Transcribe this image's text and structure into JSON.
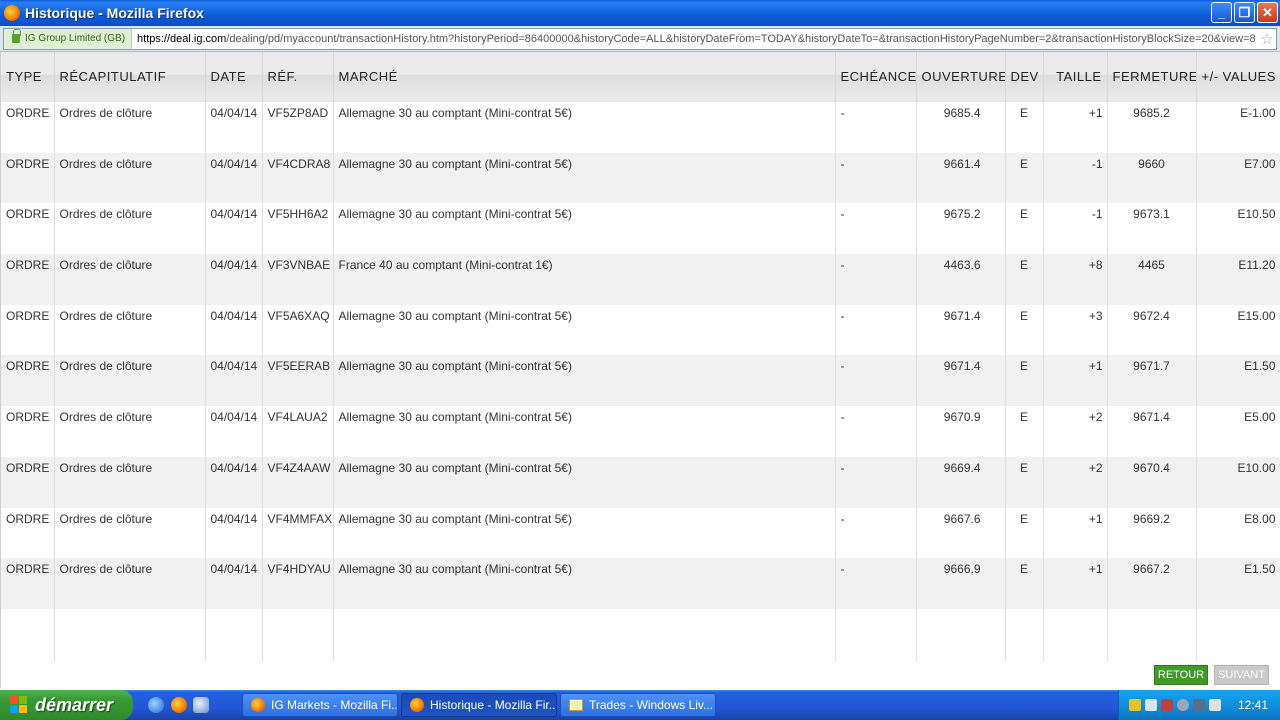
{
  "window": {
    "title": "Historique - Mozilla Firefox",
    "minimize": "_",
    "maximize": "❐",
    "close": "✕"
  },
  "address": {
    "site_identity": "IG Group Limited (GB)",
    "url_host": "https://deal.ig.com",
    "url_rest": "/dealing/pd/myaccount/transactionHistory.htm?historyPeriod=86400000&historyCode=ALL&historyDateFrom=TODAY&historyDateTo=&transactionHistoryPageNumber=2&transactionHistoryBlockSize=20&view=8"
  },
  "table": {
    "headers": [
      "TYPE",
      "RÉCAPITULATIF",
      "DATE",
      "RÉF.",
      "MARCHÉ",
      "ECHÉANCE",
      "OUVERTURE",
      "DEV",
      "TAILLE",
      "FERMETURE",
      "+/- VALUES"
    ],
    "rows": [
      [
        "ORDRE",
        "Ordres de clôture",
        "04/04/14",
        "VF5ZP8AD",
        "Allemagne 30 au comptant (Mini-contrat 5€)",
        "-",
        "9685.4",
        "E",
        "+1",
        "9685.2",
        "E-1.00"
      ],
      [
        "ORDRE",
        "Ordres de clôture",
        "04/04/14",
        "VF4CDRA8",
        "Allemagne 30 au comptant (Mini-contrat 5€)",
        "-",
        "9661.4",
        "E",
        "-1",
        "9660",
        "E7.00"
      ],
      [
        "ORDRE",
        "Ordres de clôture",
        "04/04/14",
        "VF5HH6A2",
        "Allemagne 30 au comptant (Mini-contrat 5€)",
        "-",
        "9675.2",
        "E",
        "-1",
        "9673.1",
        "E10.50"
      ],
      [
        "ORDRE",
        "Ordres de clôture",
        "04/04/14",
        "VF3VNBAE",
        "France 40 au comptant (Mini-contrat 1€)",
        "-",
        "4463.6",
        "E",
        "+8",
        "4465",
        "E11.20"
      ],
      [
        "ORDRE",
        "Ordres de clôture",
        "04/04/14",
        "VF5A6XAQ",
        "Allemagne 30 au comptant (Mini-contrat 5€)",
        "-",
        "9671.4",
        "E",
        "+3",
        "9672.4",
        "E15.00"
      ],
      [
        "ORDRE",
        "Ordres de clôture",
        "04/04/14",
        "VF5EERAB",
        "Allemagne 30 au comptant (Mini-contrat 5€)",
        "-",
        "9671.4",
        "E",
        "+1",
        "9671.7",
        "E1.50"
      ],
      [
        "ORDRE",
        "Ordres de clôture",
        "04/04/14",
        "VF4LAUA2",
        "Allemagne 30 au comptant (Mini-contrat 5€)",
        "-",
        "9670.9",
        "E",
        "+2",
        "9671.4",
        "E5.00"
      ],
      [
        "ORDRE",
        "Ordres de clôture",
        "04/04/14",
        "VF4Z4AAW",
        "Allemagne 30 au comptant (Mini-contrat 5€)",
        "-",
        "9669.4",
        "E",
        "+2",
        "9670.4",
        "E10.00"
      ],
      [
        "ORDRE",
        "Ordres de clôture",
        "04/04/14",
        "VF4MMFAX",
        "Allemagne 30 au comptant (Mini-contrat 5€)",
        "-",
        "9667.6",
        "E",
        "+1",
        "9669.2",
        "E8.00"
      ],
      [
        "ORDRE",
        "Ordres de clôture",
        "04/04/14",
        "VF4HDYAU",
        "Allemagne 30 au comptant (Mini-contrat 5€)",
        "-",
        "9666.9",
        "E",
        "+1",
        "9667.2",
        "E1.50"
      ]
    ]
  },
  "buttons": {
    "back": "RETOUR",
    "next": "SUIVANT"
  },
  "taskbar": {
    "start": "démarrer",
    "tasks": [
      {
        "label": "IG Markets - Mozilla Fi...",
        "icon": "firefox-icon",
        "active": false
      },
      {
        "label": "Historique - Mozilla Fir...",
        "icon": "firefox-icon",
        "active": true
      },
      {
        "label": "Trades - Windows Liv...",
        "icon": "mail-icon",
        "active": false
      }
    ],
    "clock": "12:41"
  },
  "colors": {
    "retour": "#3f9a27",
    "suivant": "#c9c9c9",
    "titlebar": "#0b5bd6"
  }
}
